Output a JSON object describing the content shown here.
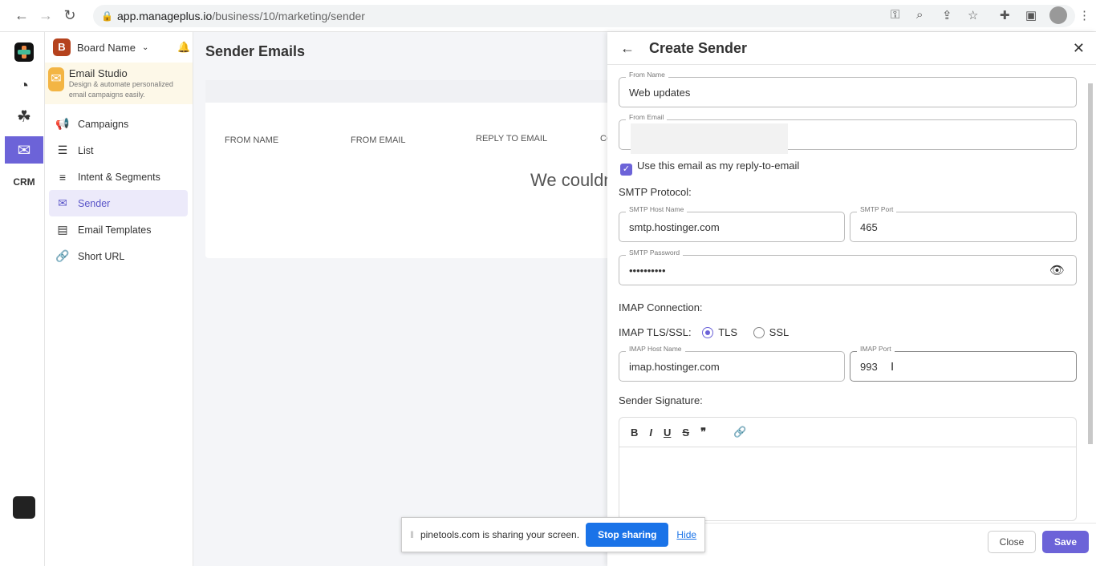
{
  "browser": {
    "url_host": "app.manageplus.io",
    "url_path": "/business/10/marketing/sender"
  },
  "sidebar": {
    "board_initial": "B",
    "board_name": "Board Name",
    "app_title": "Email Studio",
    "app_desc": "Design & automate personalized email campaigns easily.",
    "items": [
      {
        "label": "Campaigns",
        "icon": "megaphone-icon"
      },
      {
        "label": "List",
        "icon": "list-icon"
      },
      {
        "label": "Intent & Segments",
        "icon": "segments-icon"
      },
      {
        "label": "Sender",
        "icon": "sender-icon",
        "active": true
      },
      {
        "label": "Email Templates",
        "icon": "template-icon"
      },
      {
        "label": "Short URL",
        "icon": "link-icon"
      }
    ]
  },
  "main": {
    "title": "Sender Emails",
    "columns": [
      "FROM NAME",
      "FROM EMAIL",
      "REPLY TO EMAIL",
      "COM"
    ],
    "empty": "We couldn"
  },
  "panel": {
    "title": "Create Sender",
    "from_name_label": "From Name",
    "from_name": "Web updates",
    "from_email_label": "From Email",
    "from_email": "",
    "reply_checkbox": "Use this email as my reply-to-email",
    "reply_checked": true,
    "smtp_title": "SMTP Protocol:",
    "smtp_host_label": "SMTP Host Name",
    "smtp_host": "smtp.hostinger.com",
    "smtp_port_label": "SMTP Port",
    "smtp_port": "465",
    "smtp_pass_label": "SMTP Password",
    "smtp_pass": "••••••••••",
    "imap_title": "IMAP Connection:",
    "imap_tls_label": "IMAP TLS/SSL:",
    "tls": "TLS",
    "ssl": "SSL",
    "imap_selected": "TLS",
    "imap_host_label": "IMAP Host Name",
    "imap_host": "imap.hostinger.com",
    "imap_port_label": "IMAP Port",
    "imap_port": "993",
    "signature_title": "Sender Signature:",
    "close": "Close",
    "save": "Save"
  },
  "share_bar": {
    "text": "pinetools.com is sharing your screen.",
    "stop": "Stop sharing",
    "hide": "Hide"
  },
  "colors": {
    "accent": "#6c63d8",
    "share_blue": "#1a73e8"
  }
}
